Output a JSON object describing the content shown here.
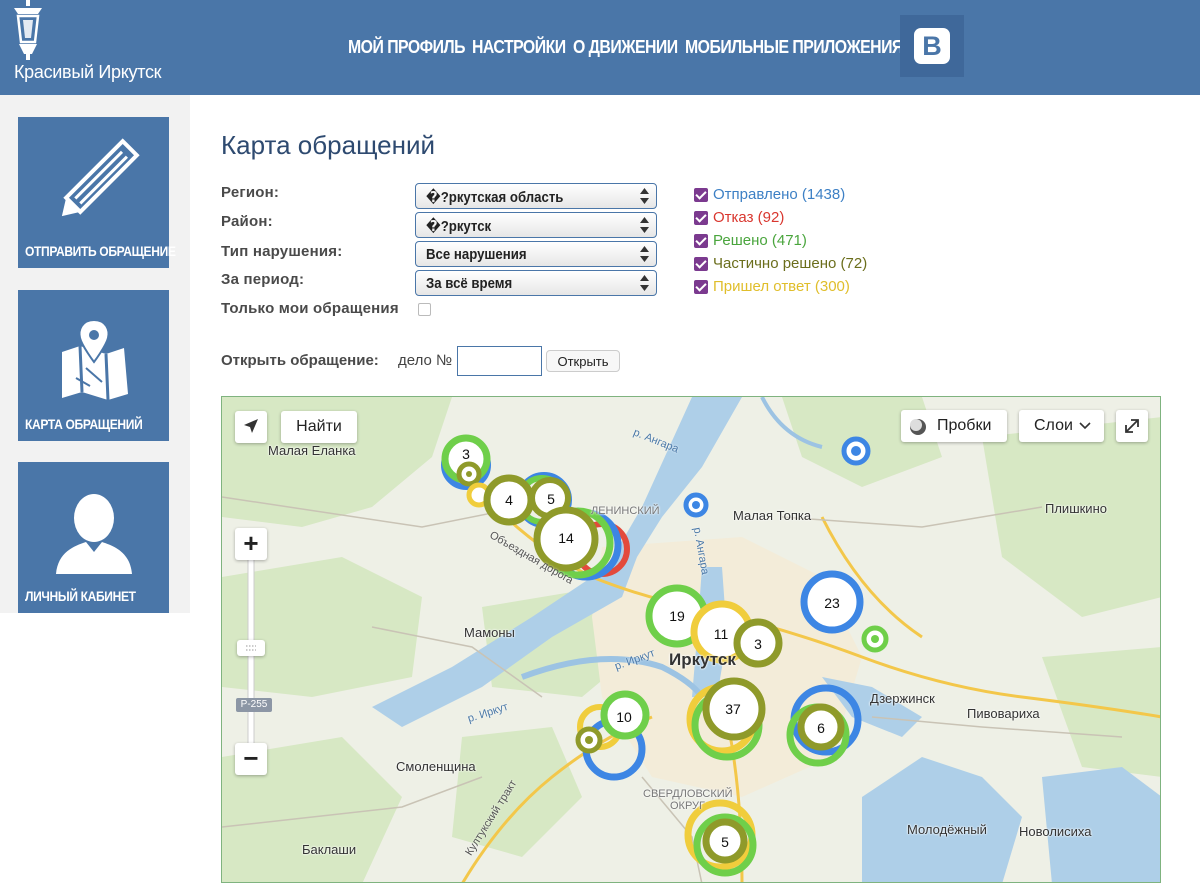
{
  "header": {
    "site_title": "Красивый Иркутск",
    "nav": [
      {
        "label": "МОЙ ПРОФИЛЬ"
      },
      {
        "label": "НАСТРОЙКИ"
      },
      {
        "label": "О ДВИЖЕНИИ"
      },
      {
        "label": "МОБИЛЬНЫЕ ПРИЛОЖЕНИЯ"
      }
    ],
    "vk_letter": "B"
  },
  "sidebar": {
    "items": [
      {
        "label": "ОТПРАВИТЬ ОБРАЩЕНИЕ",
        "icon": "pencil-icon"
      },
      {
        "label": "КАРТА ОБРАЩЕНИЙ",
        "icon": "map-pin-icon"
      },
      {
        "label": "ЛИЧНЫЙ КАБИНЕТ",
        "icon": "user-silhouette-icon"
      }
    ]
  },
  "page": {
    "title": "Карта обращений"
  },
  "filters": {
    "region_label": "Регион:",
    "region_value": "�?ркутская область",
    "district_label": "Район:",
    "district_value": "�?ркутск",
    "violation_label": "Тип нарушения:",
    "violation_value": "Все нарушения",
    "period_label": "За период:",
    "period_value": "За всё время",
    "my_only_label": "Только мои обращения"
  },
  "legend": [
    {
      "label": "Отправлено (1438)",
      "color": "#3d80c5"
    },
    {
      "label": "Отказ (92)",
      "color": "#d9372f"
    },
    {
      "label": "Решено (471)",
      "color": "#4aa53d"
    },
    {
      "label": "Частично решено (72)",
      "color": "#6b6e1c"
    },
    {
      "label": "Пришел ответ (300)",
      "color": "#e0be2b"
    }
  ],
  "open_case": {
    "label": "Открыть обращение:",
    "case_label": "дело №",
    "input_value": "",
    "button_label": "Открыть"
  },
  "map": {
    "find_button": "Найти",
    "traffic_button": "Пробки",
    "layers_button": "Слои",
    "zoom_in": "+",
    "zoom_out": "−",
    "road_badge": "Р-255",
    "places": {
      "malaya_elanka": "Малая Еланка",
      "malaya_topka": "Малая Топка",
      "plishkino": "Плишкино",
      "mamony": "Мамоны",
      "irkutsk": "Иркутск",
      "dzerzhinsk": "Дзержинск",
      "pivovariha": "Пивовариха",
      "smolenshchina": "Смоленщина",
      "molodezhny": "Молодёжный",
      "novolisiha": "Новолисиха",
      "baklashi": "Баклаши",
      "sverdlovsky": "СВЕРДЛОВСКИЙ",
      "okrug": "ОКРУГ",
      "leninsky": "ЛЕНИНСКИЙ",
      "river_angara_1": "р. Ангара",
      "river_angara_2": "р. Ангара",
      "river_irkut_1": "р. Иркут",
      "river_irkut_2": "р. Иркут",
      "road_obezdnaya": "Объездная дорога",
      "road_kultuk": "Култукский тракт"
    },
    "clusters": [
      {
        "count": "3"
      },
      {
        "count": "4"
      },
      {
        "count": "5"
      },
      {
        "count": "14"
      },
      {
        "count": "19"
      },
      {
        "count": "11"
      },
      {
        "count": "3"
      },
      {
        "count": "23"
      },
      {
        "count": "37"
      },
      {
        "count": "6"
      },
      {
        "count": "10"
      },
      {
        "count": "5"
      }
    ]
  }
}
